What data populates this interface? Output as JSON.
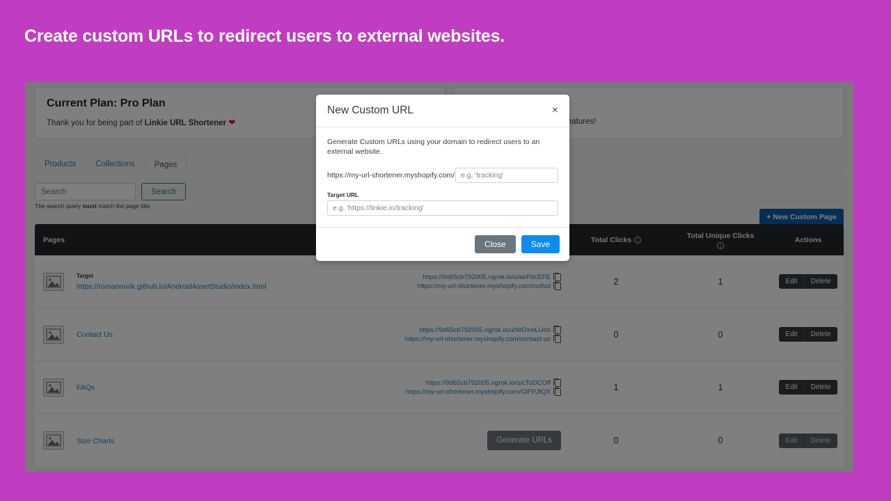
{
  "headline": "Create custom URLs to redirect users to external websites.",
  "theme": {
    "background": "#c03cc0",
    "panel": "#f2f2f2",
    "table_header": "#23272b",
    "link": "#2a7ab0",
    "primary_blue": "#0d8bf2",
    "secondary_gray": "#6c757d",
    "success_green": "#2e8b57",
    "heart": "#d11a2a"
  },
  "plan_card": {
    "title": "Current Plan: Pro Plan",
    "text_before": "Thank you for being part of ",
    "brand": "Linkie URL Shortener",
    "heart_icon": "heart-icon",
    "heart_glyph": "❤"
  },
  "info_card": {
    "text": "ions and get to know all the features!"
  },
  "tabs": [
    {
      "label": "Products",
      "active": false
    },
    {
      "label": "Collections",
      "active": false
    },
    {
      "label": "Pages",
      "active": true
    }
  ],
  "search": {
    "placeholder": "Search",
    "value": "",
    "button_label": "Search",
    "hint_before": "The search query ",
    "hint_bold": "must",
    "hint_after": " match the page title."
  },
  "new_page_button": {
    "label": "+ New Custom Page"
  },
  "table": {
    "headers": {
      "pages": "Pages",
      "urls": "",
      "total_clicks": "Total Clicks",
      "total_unique_clicks": "Total Unique Clicks",
      "actions": "Actions"
    },
    "info_glyph": "i",
    "rows": [
      {
        "thumb_icon": "image-placeholder-icon",
        "target_label": "Target",
        "page_title": "https://romannurik.github.io/AndroidAssetStudio/index.html",
        "short_url": "https://9d65cb792005.ngrok.io/u/aePdcEFE",
        "custom_url": "https://my-url-shortener.myshopify.com/rsdfsd",
        "has_urls": true,
        "generate_label": "",
        "total_clicks": "2",
        "total_unique_clicks": "1",
        "edit_label": "Edit",
        "delete_label": "Delete",
        "actions_disabled": false
      },
      {
        "thumb_icon": "image-placeholder-icon",
        "target_label": "",
        "page_title": "Contact Us",
        "short_url": "https://9d65cb792005.ngrok.io/u/WOxwLUoo",
        "custom_url": "https://my-url-shortener.myshopify.com/contact-us",
        "has_urls": true,
        "generate_label": "",
        "total_clicks": "0",
        "total_unique_clicks": "0",
        "edit_label": "Edit",
        "delete_label": "Delete",
        "actions_disabled": false
      },
      {
        "thumb_icon": "image-placeholder-icon",
        "target_label": "",
        "page_title": "FAQs",
        "short_url": "https://9d65cb792005.ngrok.io/u/cToDCOff",
        "custom_url": "https://my-url-shortener.myshopify.com/GlFPJfQX",
        "has_urls": true,
        "generate_label": "",
        "total_clicks": "1",
        "total_unique_clicks": "1",
        "edit_label": "Edit",
        "delete_label": "Delete",
        "actions_disabled": false
      },
      {
        "thumb_icon": "image-placeholder-icon",
        "target_label": "",
        "page_title": "Size Charts",
        "short_url": "",
        "custom_url": "",
        "has_urls": false,
        "generate_label": "Generate URLs",
        "total_clicks": "0",
        "total_unique_clicks": "0",
        "edit_label": "Edit",
        "delete_label": "Delete",
        "actions_disabled": true
      }
    ]
  },
  "modal": {
    "title": "New Custom URL",
    "close_glyph": "×",
    "description": "Generate Custom URLs using your domain to redirect users to an external website.",
    "domain_prefix": "https://my-url-shortener.myshopify.com/",
    "slug_placeholder": "e.g. 'tracking'",
    "slug_value": "",
    "target_label": "Target URL",
    "target_placeholder": "e.g. 'https://linkie.io/tracking'",
    "target_value": "",
    "close_label": "Close",
    "save_label": "Save"
  }
}
